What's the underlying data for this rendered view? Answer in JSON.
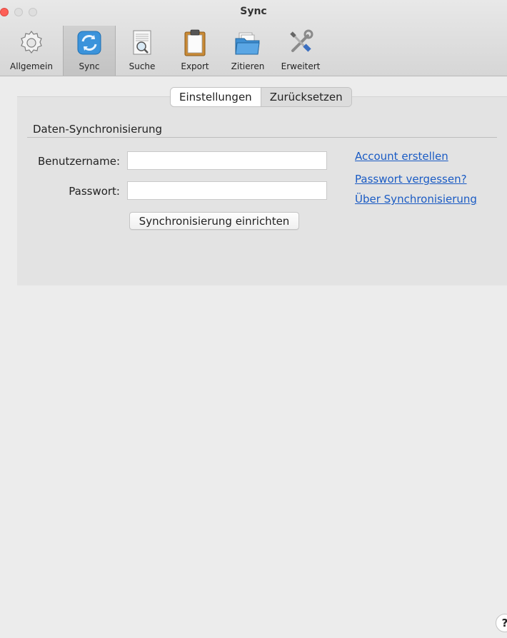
{
  "window": {
    "title": "Sync",
    "traffic_colors": {
      "close": "#fd5f57",
      "inactive": "#dedede"
    }
  },
  "toolbar": {
    "items": [
      {
        "label": "Allgemein",
        "icon": "gear-icon"
      },
      {
        "label": "Sync",
        "icon": "sync-icon",
        "selected": true
      },
      {
        "label": "Suche",
        "icon": "search-document-icon"
      },
      {
        "label": "Export",
        "icon": "clipboard-icon"
      },
      {
        "label": "Zitieren",
        "icon": "folder-icon"
      },
      {
        "label": "Erweitert",
        "icon": "tools-icon"
      }
    ]
  },
  "tabs": {
    "settings": "Einstellungen",
    "reset": "Zurücksetzen",
    "active": "settings"
  },
  "section": {
    "title": "Daten-Synchronisierung"
  },
  "form": {
    "username_label": "Benutzername:",
    "username_value": "",
    "password_label": "Passwort:",
    "password_value": "",
    "setup_button": "Synchronisierung einrichten"
  },
  "links": {
    "create_account": "Account erstellen",
    "forgot_password": "Passwort vergessen?",
    "about_sync": "Über Synchronisierung"
  },
  "help": {
    "label": "?"
  },
  "colors": {
    "link": "#1a5bc4",
    "sync_icon": "#2a8bd6"
  }
}
